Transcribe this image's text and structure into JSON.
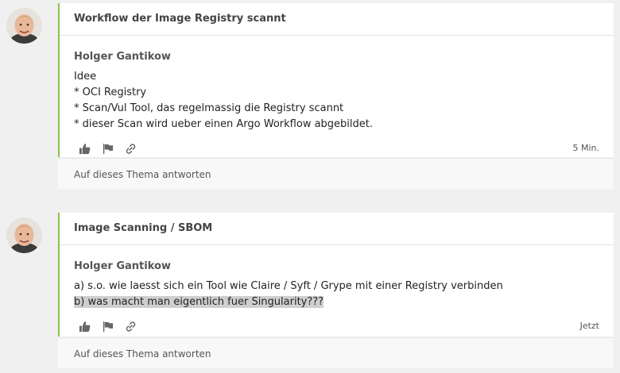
{
  "topics": [
    {
      "title": "Workflow der Image Registry scannt",
      "author": "Holger Gantikow",
      "lines": [
        "Idee",
        "* OCI Registry",
        "* Scan/Vul Tool, das regelmassig die Registry scannt",
        "* dieser Scan wird ueber einen Argo Workflow abgebildet."
      ],
      "time": "5 Min.",
      "reply_label": "Auf dieses Thema antworten"
    },
    {
      "title": "Image Scanning / SBOM",
      "author": "Holger Gantikow",
      "lines": [
        "a) s.o. wie laesst sich ein Tool wie Claire / Syft / Grype mit einer Registry verbinden",
        "b) was macht man eigentlich fuer Singularity???"
      ],
      "time": "Jetzt",
      "reply_label": "Auf dieses Thema antworten"
    }
  ],
  "icons": {
    "like": "thumbs-up-icon",
    "flag": "flag-icon",
    "link": "link-icon"
  },
  "colors": {
    "accent": "#8bc34a",
    "highlight": "#cfcfcf"
  }
}
